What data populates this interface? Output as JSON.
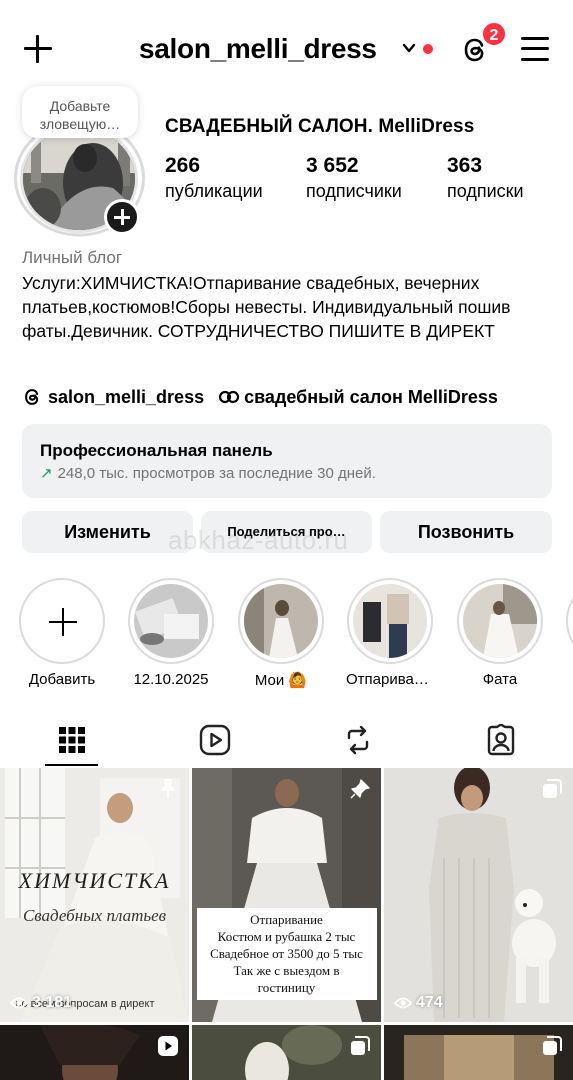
{
  "header": {
    "username": "salon_melli_dress",
    "notification_count": "2"
  },
  "note": {
    "text": "Добавьте зловещую…"
  },
  "profile": {
    "full_name": "СВАДЕБНЫЙ САЛОН. MelliDress",
    "stats": [
      {
        "value": "266",
        "label": "публикации"
      },
      {
        "value": "3 652",
        "label": "подписчики"
      },
      {
        "value": "363",
        "label": "подписки"
      }
    ],
    "category": "Личный блог",
    "bio": "Услуги:ХИМЧИСТКА!Отпаривание свадебных, вечерних платьев,костюмов!Сборы невесты. Индивидуальный пошив фаты.Девичник. СОТРУДНИЧЕСТВО ПИШИТЕ В ДИРЕКТ",
    "links": [
      {
        "icon": "threads-icon",
        "text": "salon_melli_dress"
      },
      {
        "icon": "link-icon",
        "text": "свадебный салон MelliDress"
      }
    ]
  },
  "pro_panel": {
    "title": "Профессиональная панель",
    "subtitle": "248,0 тыс. просмотров за последние 30 дней."
  },
  "buttons": {
    "edit": "Изменить",
    "share": "Поделиться про…",
    "call": "Позвонить"
  },
  "watermark": "abkhaz-auto.ru",
  "highlights": [
    {
      "label": "Добавить"
    },
    {
      "label": "12.10.2025"
    },
    {
      "label": "Мои 🙆"
    },
    {
      "label": "Отпариван…"
    },
    {
      "label": "Фата"
    }
  ],
  "tabs": [
    "grid-icon",
    "reels-icon",
    "reposts-icon",
    "tagged-icon"
  ],
  "grid": [
    {
      "caption_1": "ХИМЧИСТКА",
      "caption_2": "Свадебных платьев",
      "caption_3": "по всем вопросам в директ",
      "views": "3 181",
      "icon": "pin-icon"
    },
    {
      "lines": [
        "Отпаривание",
        "Костюм и рубашка 2 тыс",
        "Свадебное от 3500 до 5 тыс",
        "Так же с выездом в",
        "гостиницу"
      ],
      "icon": "pin-icon"
    },
    {
      "views": "474",
      "icon": "carousel-icon"
    }
  ],
  "colors": {
    "accent_red": "#ff3040",
    "panel_bg": "#eff1f3",
    "secondary_text": "#737373",
    "trend_green": "#1f9d55"
  }
}
